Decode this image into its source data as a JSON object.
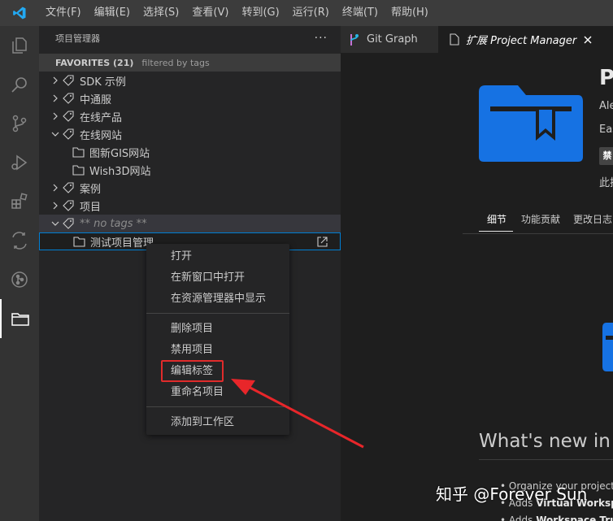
{
  "menubar": {
    "items": [
      "文件(F)",
      "编辑(E)",
      "选择(S)",
      "查看(V)",
      "转到(G)",
      "运行(R)",
      "终端(T)",
      "帮助(H)"
    ]
  },
  "sidebar": {
    "title": "项目管理器",
    "more": "···",
    "section": {
      "title": "FAVORITES (21)",
      "description": "filtered by tags"
    },
    "tree": [
      {
        "label": "SDK 示例",
        "kind": "tag",
        "expanded": false
      },
      {
        "label": "中通服",
        "kind": "tag",
        "expanded": false
      },
      {
        "label": "在线产品",
        "kind": "tag",
        "expanded": false
      },
      {
        "label": "在线网站",
        "kind": "tag",
        "expanded": true
      },
      {
        "label": "图新GIS网站",
        "kind": "project"
      },
      {
        "label": "Wish3D网站",
        "kind": "project"
      },
      {
        "label": "案例",
        "kind": "tag",
        "expanded": false
      },
      {
        "label": "项目",
        "kind": "tag",
        "expanded": false
      },
      {
        "label": "** no tags **",
        "kind": "tag",
        "expanded": true
      },
      {
        "label": "测试项目管理",
        "kind": "project"
      }
    ]
  },
  "tabs": [
    {
      "label": "Git Graph",
      "active": false
    },
    {
      "label": "扩展 Project Manager",
      "active": true
    }
  ],
  "extension": {
    "title": "P",
    "author": "Ale",
    "description": "Eas",
    "badge": "禁",
    "line": "此扩",
    "detail_tabs": [
      "细节",
      "功能贡献",
      "更改日志"
    ],
    "whats_new": "What's new in",
    "bullets": [
      {
        "text": "Organize your project"
      },
      {
        "prefix": "Adds ",
        "bold": "Virtual Workspa"
      },
      {
        "prefix": "Adds ",
        "bold": "Workspace Tru"
      }
    ]
  },
  "context_menu": {
    "groups": [
      [
        "打开",
        "在新窗口中打开",
        "在资源管理器中显示"
      ],
      [
        "删除项目",
        "禁用项目",
        "编辑标签",
        "重命名项目"
      ],
      [
        "添加到工作区"
      ]
    ]
  },
  "watermark": "知乎 @Forever Sun",
  "colors": {
    "accent": "#007fd4",
    "folder_blue": "#1672e3",
    "highlight_red": "#e02b2b",
    "arrow_red": "#e8262a"
  }
}
